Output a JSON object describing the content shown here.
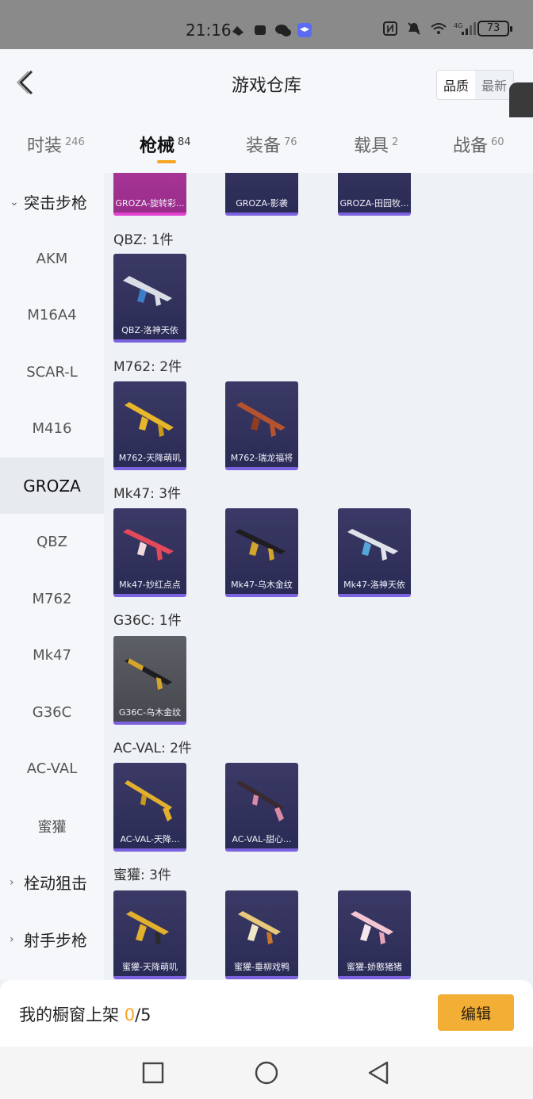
{
  "status_bar": {
    "time": "21:16",
    "battery": "73"
  },
  "header": {
    "title": "游戏仓库",
    "sort_quality": "品质",
    "sort_latest": "最新"
  },
  "tabs": [
    {
      "label": "时装",
      "count": "246"
    },
    {
      "label": "枪械",
      "count": "84"
    },
    {
      "label": "装备",
      "count": "76"
    },
    {
      "label": "载具",
      "count": "2"
    },
    {
      "label": "战备",
      "count": "60"
    }
  ],
  "sidebar": {
    "category_assault": "突击步枪",
    "items": [
      "AKM",
      "M16A4",
      "SCAR-L",
      "M416",
      "GROZA",
      "QBZ",
      "M762",
      "Mk47",
      "G36C",
      "AC-VAL",
      "蜜獾"
    ],
    "category_bolt": "栓动狙击",
    "category_marksman": "射手步枪"
  },
  "content": {
    "top_items": [
      "GROZA-旋转彩...",
      "GROZA-影袭",
      "GROZA-田园牧..."
    ],
    "groups": [
      {
        "title": "QBZ: 1件",
        "items": [
          "QBZ-洛神天依"
        ]
      },
      {
        "title": "M762: 2件",
        "items": [
          "M762-天降萌叽",
          "M762-瑞龙福将"
        ]
      },
      {
        "title": "Mk47: 3件",
        "items": [
          "Mk47-妙红点点",
          "Mk47-乌木金纹",
          "Mk47-洛神天依"
        ]
      },
      {
        "title": "G36C: 1件",
        "items": [
          "G36C-乌木金纹"
        ]
      },
      {
        "title": "AC-VAL: 2件",
        "items": [
          "AC-VAL-天降...",
          "AC-VAL-甜心..."
        ]
      },
      {
        "title": "蜜獾: 3件",
        "items": [
          "蜜獾-天降萌叽",
          "蜜獾-垂柳戏鸭",
          "蜜獾-娇憨猪猪"
        ]
      }
    ]
  },
  "bottom": {
    "shelf_label": "我的橱窗上架 ",
    "shelf_count": "0",
    "shelf_total": "/5",
    "edit_label": "编辑"
  },
  "colors": {
    "accent": "#f5a623",
    "item_bg": "#2f2f5a",
    "item_border": "#7d62e0"
  }
}
